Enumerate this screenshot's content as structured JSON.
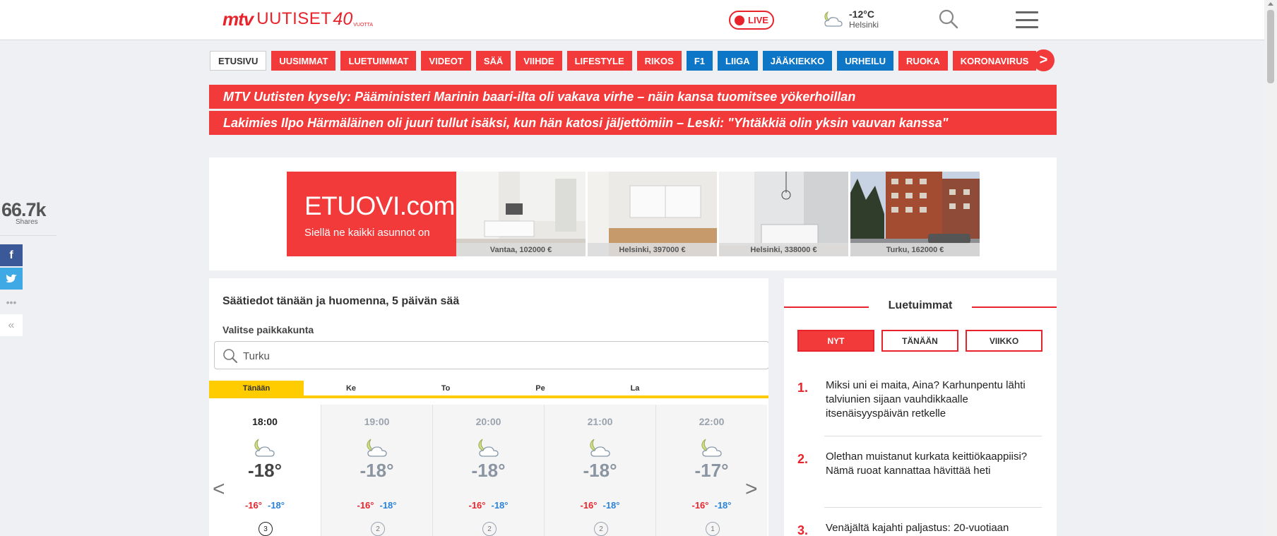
{
  "header": {
    "logo": {
      "brand": "mtv",
      "name": "UUTISET",
      "badge": "40",
      "badge_sub": "VUOTTA"
    },
    "live_label": "LIVE",
    "weather": {
      "temperature": "-12°C",
      "city": "Helsinki",
      "icon": "moon-cloud-icon"
    },
    "search_icon": "search-icon",
    "menu_icon": "hamburger-menu-icon"
  },
  "nav": {
    "tabs": [
      {
        "label": "ETUSIVU",
        "style": "home"
      },
      {
        "label": "UUSIMMAT",
        "style": "red"
      },
      {
        "label": "LUETUIMMAT",
        "style": "red"
      },
      {
        "label": "VIDEOT",
        "style": "red"
      },
      {
        "label": "SÄÄ",
        "style": "red"
      },
      {
        "label": "VIIHDE",
        "style": "red"
      },
      {
        "label": "LIFESTYLE",
        "style": "red"
      },
      {
        "label": "RIKOS",
        "style": "red"
      },
      {
        "label": "F1",
        "style": "blue"
      },
      {
        "label": "LIIGA",
        "style": "blue"
      },
      {
        "label": "JÄÄKIEKKO",
        "style": "blue"
      },
      {
        "label": "URHEILU",
        "style": "blue"
      },
      {
        "label": "RUOKA",
        "style": "red"
      },
      {
        "label": "KORONAVIRUS",
        "style": "red"
      }
    ],
    "next_label": ">"
  },
  "breaking": [
    "MTV Uutisten kysely: Pääministeri Marinin baari-ilta oli vakava virhe – näin kansa tuomitsee yökerhoillan",
    "Lakimies Ilpo Härmäläinen oli juuri tullut isäksi, kun hän katosi jäljettömiin – Leski: \"Yhtäkkiä olin yksin vauvan kanssa\""
  ],
  "share": {
    "count": "66.7k",
    "label": "Shares",
    "more": "•••",
    "collapse": "«"
  },
  "ad": {
    "brand": "ETUOVI",
    "brand_suffix": ".com",
    "tagline": "Siellä ne kaikki asunnot on",
    "listings": [
      {
        "caption": "Vantaa, 102000 €"
      },
      {
        "caption": "Helsinki, 397000 €"
      },
      {
        "caption": "Helsinki, 338000 €"
      },
      {
        "caption": "Turku, 162000 €"
      }
    ]
  },
  "weather": {
    "title": "Säätiedot tänään ja huomenna, 5 päivän sää",
    "location_label": "Valitse paikkakunta",
    "location_value": "Turku",
    "days": [
      "Tänään",
      "Ke",
      "To",
      "Pe",
      "La"
    ],
    "hours": [
      {
        "time": "18:00",
        "temp": "-18°",
        "high": "-16°",
        "low": "-18°",
        "wind": "3"
      },
      {
        "time": "19:00",
        "temp": "-18°",
        "high": "-16°",
        "low": "-18°",
        "wind": "2"
      },
      {
        "time": "20:00",
        "temp": "-18°",
        "high": "-16°",
        "low": "-18°",
        "wind": "2"
      },
      {
        "time": "21:00",
        "temp": "-18°",
        "high": "-16°",
        "low": "-18°",
        "wind": "2"
      },
      {
        "time": "22:00",
        "temp": "-17°",
        "high": "-16°",
        "low": "-18°",
        "wind": "1"
      }
    ],
    "prev_label": "<",
    "next_label": ">"
  },
  "popular": {
    "title": "Luetuimmat",
    "tabs": [
      "NYT",
      "TÄNÄÄN",
      "VIIKKO"
    ],
    "items": [
      {
        "num": "1.",
        "title": "Miksi uni ei maita, Aina? Karhunpentu lähti talviunien sijaan vauhdikkaalle itsenäisyyspäivän retkelle"
      },
      {
        "num": "2.",
        "title": "Olethan muistanut kurkata keittiökaappiisi? Nämä ruoat kannattaa hävittää heti"
      },
      {
        "num": "3.",
        "title": "Venäjältä kajahti paljastus: 20-vuotiaan"
      }
    ]
  },
  "colors": {
    "brand_red": "#f23a3a",
    "sport_blue": "#0e76c6",
    "weather_yellow": "#ffcc00"
  }
}
